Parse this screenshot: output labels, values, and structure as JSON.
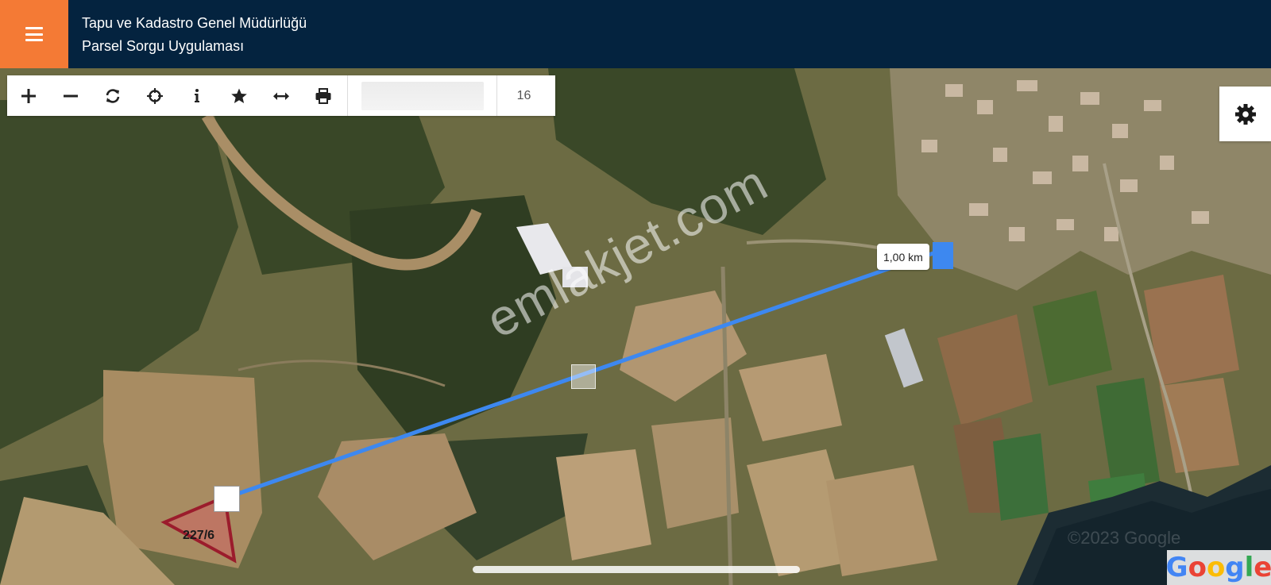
{
  "header": {
    "title_line1": "Tapu ve Kadastro Genel Müdürlüğü",
    "title_line2": "Parsel Sorgu Uygulaması",
    "menu_color": "#f47a35",
    "bar_color": "#04233f"
  },
  "toolbar": {
    "tools": [
      {
        "name": "zoom-in",
        "icon": "plus-icon"
      },
      {
        "name": "zoom-out",
        "icon": "minus-icon"
      },
      {
        "name": "refresh",
        "icon": "refresh-icon"
      },
      {
        "name": "locate",
        "icon": "crosshair-icon"
      },
      {
        "name": "info",
        "icon": "info-icon"
      },
      {
        "name": "favorites",
        "icon": "star-icon"
      },
      {
        "name": "measure",
        "icon": "double-arrow-icon"
      },
      {
        "name": "print",
        "icon": "printer-icon"
      }
    ],
    "search_value": "",
    "zoom_level": "16"
  },
  "map": {
    "measure_label": "1,00 km",
    "measure_line_color": "#3d88f0",
    "parcel_label": "227/6",
    "parcel_color": "#9b1c2c",
    "watermark": "emlakjet.com",
    "copyright": "©2023 Google",
    "logo": [
      "G",
      "o",
      "o",
      "g",
      "l",
      "e"
    ]
  },
  "settings": {
    "icon": "gear-icon"
  }
}
